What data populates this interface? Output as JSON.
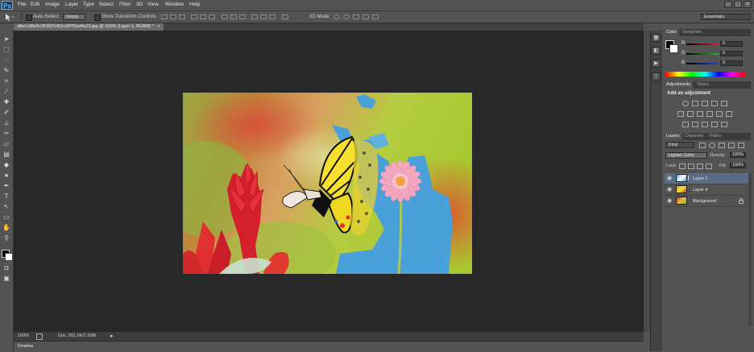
{
  "app": {
    "logo": "Ps"
  },
  "menu": [
    "File",
    "Edit",
    "Image",
    "Layer",
    "Type",
    "Select",
    "Filter",
    "3D",
    "View",
    "Window",
    "Help"
  ],
  "window_controls": {
    "minimize": "–",
    "maximize": "□",
    "close": "×"
  },
  "options_bar": {
    "auto_select_label": "Auto-Select:",
    "auto_select_value": "Group",
    "show_transform_label": "Show Transform Controls",
    "mode_3d_label": "3D Mode:",
    "workspace": "Essentials"
  },
  "document": {
    "tab_title": "a8e1c88e9c0530f7c82cc8f7f5ad4a15.jpg @ 100% (Layer 1, RGB/8) *",
    "tab_close": "×"
  },
  "status": {
    "zoom": "100%",
    "doc_info": "Doc: 991.9K/2.50M",
    "arrow": "▸"
  },
  "timeline": {
    "label": "Timeline"
  },
  "color_panel": {
    "tabs": [
      "Color",
      "Swatches"
    ],
    "channels": [
      {
        "label": "R",
        "value": "0",
        "color": "#e02020"
      },
      {
        "label": "G",
        "value": "0",
        "color": "#20c030"
      },
      {
        "label": "B",
        "value": "0",
        "color": "#2040e0"
      }
    ]
  },
  "adjustments_panel": {
    "tabs": [
      "Adjustments",
      "Styles"
    ],
    "heading": "Add an adjustment"
  },
  "layers_panel": {
    "tabs": [
      "Layers",
      "Channels",
      "Paths"
    ],
    "filter_kind": "Kind",
    "blend_mode": "Lighter Color",
    "opacity_label": "Opacity:",
    "opacity_value": "100%",
    "lock_label": "Lock:",
    "fill_label": "Fill:",
    "fill_value": "100%",
    "layers": [
      {
        "name": "Layer 1",
        "selected": true
      },
      {
        "name": "Layer 4",
        "selected": false
      },
      {
        "name": "Background",
        "selected": false,
        "locked": true
      }
    ]
  },
  "icons": {
    "move": "move-tool-icon",
    "eye": "eye-icon",
    "lock": "lock-icon"
  }
}
